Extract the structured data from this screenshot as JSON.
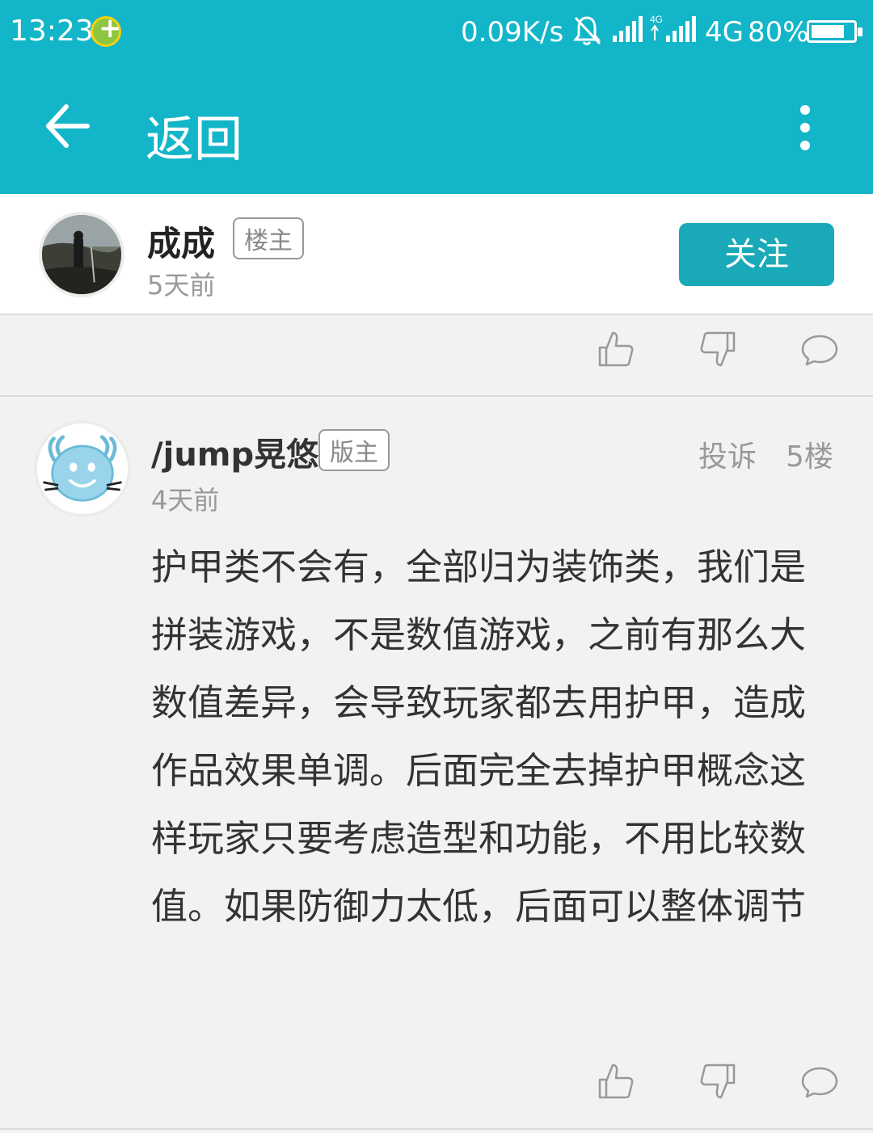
{
  "status_bar": {
    "time": "13:23",
    "speed": "0.09K/s",
    "network": "4G",
    "battery": "80%",
    "battery_level": 0.8
  },
  "nav": {
    "title": "返回",
    "icons": [
      "back-arrow-icon",
      "more-vertical-icon"
    ]
  },
  "op": {
    "name": "成成",
    "badge": "楼主",
    "time": "5天前",
    "follow_label": "关注"
  },
  "reply": {
    "name": "/jump晃悠",
    "badge": "版主",
    "time": "4天前",
    "report_label": "投诉",
    "floor": "5楼",
    "text": "护甲类不会有，全部归为装饰类，我们是拼装游戏，不是数值游戏，之前有那么大数值差异，会导致玩家都去用护甲，造成作品效果单调。后面完全去掉护甲概念这样玩家只要考虑造型和功能，不用比较数值。如果防御力太低，后面可以整体调节"
  },
  "colors": {
    "header": "#13b5c8",
    "follow_button": "#1aa9b8",
    "background": "#f2f2f2"
  }
}
